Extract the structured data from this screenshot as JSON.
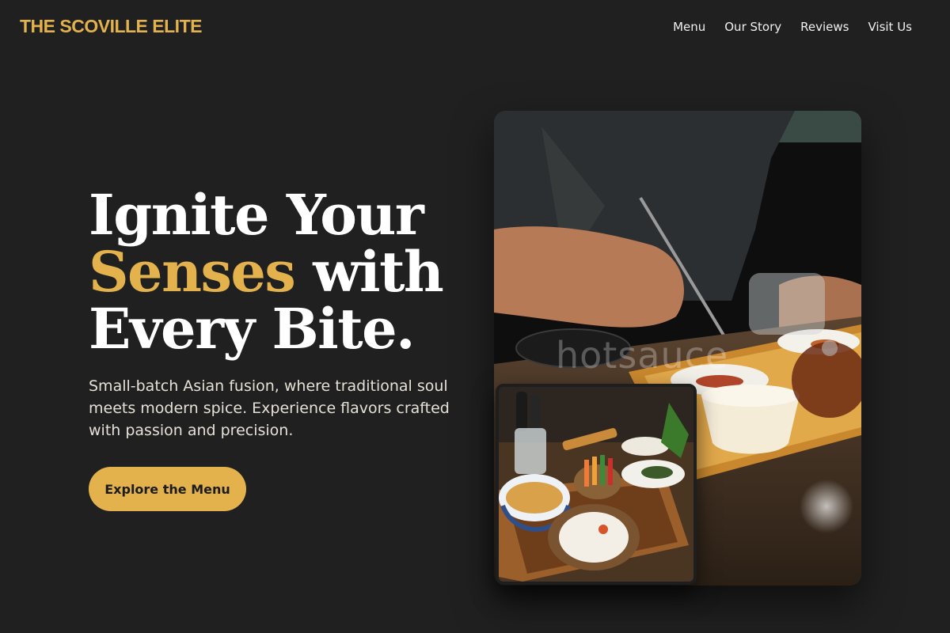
{
  "header": {
    "brand": "THE SCOVILLE ELITE",
    "nav": [
      "Menu",
      "Our Story",
      "Reviews",
      "Visit Us"
    ]
  },
  "hero": {
    "title_line1": "Ignite Your",
    "title_accent": "Senses",
    "title_line2_rest": " with",
    "title_line3": "Every Bite.",
    "subtitle": "Small-batch Asian fusion, where traditional soul meets modern spice. Experience flavors crafted with passion and precision.",
    "cta_label": "Explore the Menu"
  },
  "images": {
    "main_photo": {
      "watermark": "hotsauce"
    },
    "inset_photo": {}
  },
  "colors": {
    "background": "#202020",
    "accent": "#e3b24d",
    "text": "#ffffff"
  }
}
